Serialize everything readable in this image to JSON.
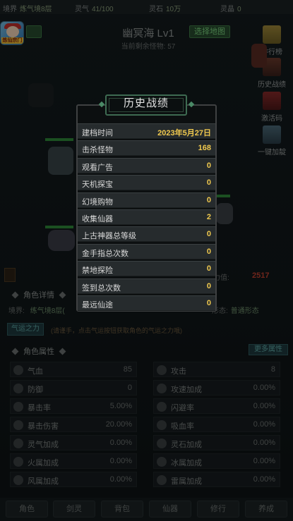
{
  "topbar": {
    "realm_label": "境界",
    "realm_value": "炼气境8层",
    "qi_label": "灵气",
    "qi_value": "41/100",
    "stone_label": "灵石",
    "stone_value": "10万",
    "jade_label": "灵晶",
    "jade_value": "0"
  },
  "avatar": {
    "tag": "炼仙宗门"
  },
  "map": {
    "title": "幽冥海 Lv1",
    "remaining_label": "当前剩余怪物:",
    "remaining_value": "57",
    "select_label": "选择地图"
  },
  "side_menu": {
    "ranking": "排行榜",
    "history": "历史战绩",
    "code": "激活码",
    "boost": "一键加靛"
  },
  "power": {
    "label": "力值:",
    "value": "2517"
  },
  "role_detail": {
    "heading": "角色详情",
    "realm_label": "境界:",
    "realm_value": "练气境8层(",
    "form_label": "形态:",
    "form_value": "普通形态",
    "qiyun_label": "气运之力",
    "qiyun_tip": "(请谨手，点击气运按钮获取角色的气运之力哦)"
  },
  "attributes": {
    "heading": "角色属性",
    "more_label": "更多属性",
    "left": [
      {
        "label": "气血",
        "value": "85",
        "icon": "heart-icon"
      },
      {
        "label": "防御",
        "value": "0",
        "icon": "armor-icon"
      },
      {
        "label": "暴击率",
        "value": "5.00%",
        "icon": "crit-icon"
      },
      {
        "label": "暴击伤害",
        "value": "20.00%",
        "icon": "crit-damage-icon"
      },
      {
        "label": "灵气加成",
        "value": "0.00%",
        "icon": "spiral-icon"
      },
      {
        "label": "火属加成",
        "value": "0.00%",
        "icon": "fire-icon"
      },
      {
        "label": "风属加成",
        "value": "0.00%",
        "icon": "wind-icon"
      }
    ],
    "right": [
      {
        "label": "攻击",
        "value": "8",
        "icon": "sword-icon"
      },
      {
        "label": "攻速加成",
        "value": "0.00%",
        "icon": "speed-icon"
      },
      {
        "label": "闪避率",
        "value": "0.00%",
        "icon": "dodge-icon"
      },
      {
        "label": "吸血率",
        "value": "0.00%",
        "icon": "vampire-icon"
      },
      {
        "label": "灵石加成",
        "value": "0.00%",
        "icon": "gem-icon"
      },
      {
        "label": "冰属加成",
        "value": "0.00%",
        "icon": "ice-icon"
      },
      {
        "label": "雷属加成",
        "value": "0.00%",
        "icon": "thunder-icon"
      }
    ]
  },
  "bottom_nav": [
    "角色",
    "剑灵",
    "背包",
    "仙器",
    "修行",
    "养成"
  ],
  "dialog": {
    "title": "历史战绩",
    "rows": [
      {
        "label": "建档时间",
        "value": "2023年5月27日"
      },
      {
        "label": "击杀怪物",
        "value": "168"
      },
      {
        "label": "观看广告",
        "value": "0"
      },
      {
        "label": "天机探宝",
        "value": "0"
      },
      {
        "label": "幻境购物",
        "value": "0"
      },
      {
        "label": "收集仙器",
        "value": "2"
      },
      {
        "label": "上古神器总等级",
        "value": "0"
      },
      {
        "label": "金手指总次数",
        "value": "0"
      },
      {
        "label": "禁地探险",
        "value": "0"
      },
      {
        "label": "签到总次数",
        "value": "0"
      },
      {
        "label": "最远仙途",
        "value": "0"
      }
    ]
  },
  "colors": {
    "accent_gold": "#f0c94e",
    "accent_green": "#3f7a46",
    "power_red": "#c0402f"
  }
}
